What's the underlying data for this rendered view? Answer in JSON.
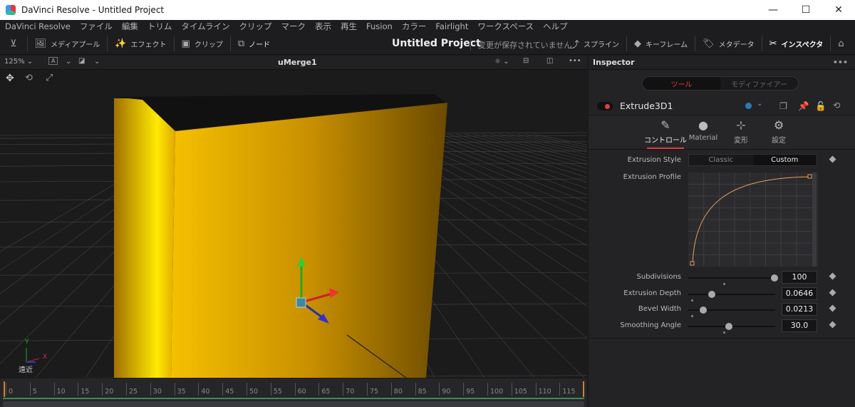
{
  "window": {
    "title": "DaVinci Resolve - Untitled Project",
    "minimize": "—",
    "maximize": "☐",
    "close": "✕"
  },
  "menu": [
    "DaVinci Resolve",
    "ファイル",
    "編集",
    "トリム",
    "タイムライン",
    "クリップ",
    "マーク",
    "表示",
    "再生",
    "Fusion",
    "カラー",
    "Fairlight",
    "ワークスペース",
    "ヘルプ"
  ],
  "toolbar": {
    "media_pool": "メディアプール",
    "effects": "エフェクト",
    "clips": "クリップ",
    "nodes": "ノード",
    "project": "Untitled Project",
    "unsaved": "変更が保存されていません",
    "spline": "スプライン",
    "keyframes": "キーフレーム",
    "metadata": "メタデータ",
    "inspector": "インスペクタ"
  },
  "viewer": {
    "zoom": "125%",
    "title": "uMerge1",
    "axis_y": "Y",
    "axis_x": "X",
    "view_label": "遠近"
  },
  "timeline": {
    "ticks": [
      "0",
      "5",
      "10",
      "15",
      "20",
      "25",
      "30",
      "35",
      "40",
      "45",
      "50",
      "55",
      "60",
      "65",
      "70",
      "75",
      "80",
      "85",
      "90",
      "95",
      "100",
      "105",
      "110",
      "115"
    ]
  },
  "inspector": {
    "title": "Inspector",
    "seg_tools": "ツール",
    "seg_modifiers": "モディファイアー",
    "node_name": "Extrude3D1",
    "tabs": [
      {
        "label": "コントロール",
        "icon": "controls-icon"
      },
      {
        "label": "Material",
        "icon": "material-icon"
      },
      {
        "label": "変形",
        "icon": "transform-icon"
      },
      {
        "label": "設定",
        "icon": "settings-icon"
      }
    ],
    "extrusion_style": {
      "label": "Extrusion Style",
      "options": [
        "Classic",
        "Custom"
      ],
      "selected": "Custom"
    },
    "extrusion_profile": {
      "label": "Extrusion Profile"
    },
    "params": [
      {
        "label": "Subdivisions",
        "value": "100",
        "fraction": 0.99,
        "default_fraction": 0.4
      },
      {
        "label": "Extrusion Depth",
        "value": "0.0646",
        "fraction": 0.27,
        "default_fraction": 0.03
      },
      {
        "label": "Bevel Width",
        "value": "0.0213",
        "fraction": 0.17,
        "default_fraction": 0.03
      },
      {
        "label": "Smoothing Angle",
        "value": "30.0",
        "fraction": 0.47,
        "default_fraction": 0.4
      }
    ]
  },
  "colors": {
    "accent": "#e0403a",
    "profile_curve": "#e0a060",
    "node_color": "#2a7ab8"
  }
}
